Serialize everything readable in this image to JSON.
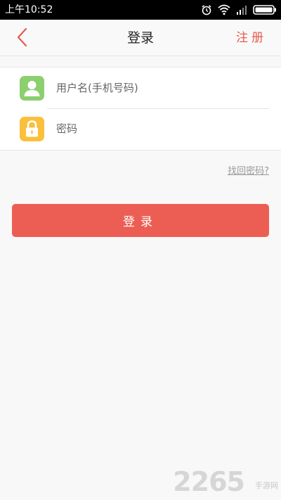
{
  "status_bar": {
    "time": "上午10:52",
    "icons": [
      "alarm-icon",
      "wifi-icon",
      "signal-icon",
      "battery-icon"
    ]
  },
  "header": {
    "title": "登录",
    "register_label": "注册",
    "back_icon": "chevron-left-icon"
  },
  "form": {
    "username": {
      "placeholder": "用户名(手机号码)",
      "value": "",
      "icon": "user-icon"
    },
    "password": {
      "placeholder": "密码",
      "value": "",
      "icon": "lock-icon"
    },
    "forgot_label": "找回密码?"
  },
  "login_button": {
    "label": "登录"
  },
  "watermark": {
    "digits": "2265",
    "text": "手游网"
  },
  "colors": {
    "accent": "#ec5e54",
    "user_icon_bg": "#8ccf6e",
    "lock_icon_bg": "#fbbf3b"
  }
}
